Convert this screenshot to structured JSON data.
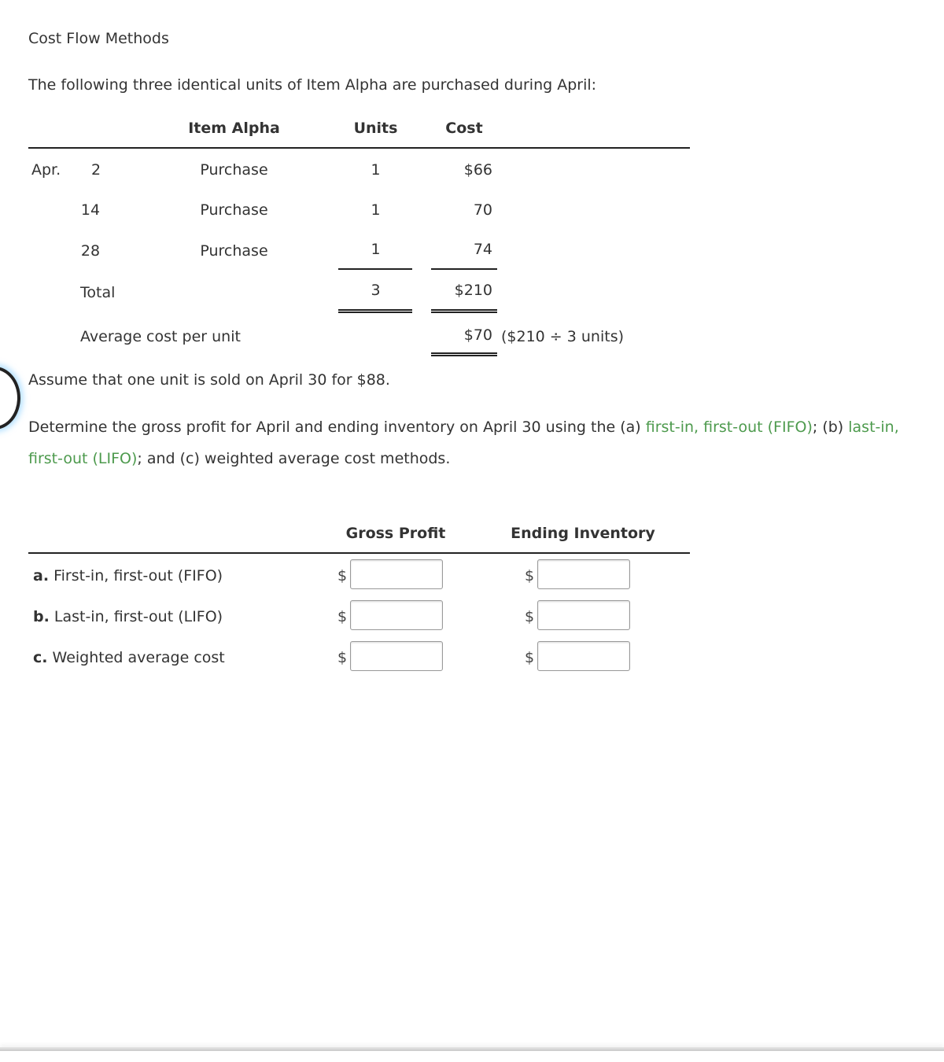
{
  "title": "Cost Flow Methods",
  "intro": "The following three identical units of Item Alpha are purchased during April:",
  "table": {
    "headers": {
      "item": "Item Alpha",
      "units": "Units",
      "cost": "Cost"
    },
    "month": "Apr.",
    "rows": [
      {
        "day": "2",
        "desc": "Purchase",
        "units": "1",
        "cost": "$66"
      },
      {
        "day": "14",
        "desc": "Purchase",
        "units": "1",
        "cost": "70"
      },
      {
        "day": "28",
        "desc": "Purchase",
        "units": "1",
        "cost": "74"
      }
    ],
    "total": {
      "label": "Total",
      "units": "3",
      "cost": "$210"
    },
    "average": {
      "label": "Average cost per unit",
      "cost": "$70",
      "note": "($210 ÷ 3 units)"
    }
  },
  "assume": "Assume that one unit is sold on April 30 for $88.",
  "question": {
    "part1": "Determine the gross profit for April and ending inventory on April 30 using the (a) ",
    "link_fifo": "first-in, first-out (FIFO)",
    "part2": "; (b) ",
    "link_lifo": "last-in, first-out (LIFO)",
    "part3": "; and (c) weighted average cost methods."
  },
  "answer": {
    "headers": {
      "gross_profit": "Gross Profit",
      "ending_inventory": "Ending Inventory"
    },
    "currency": "$",
    "rows": [
      {
        "letter": "a.",
        "label": "First-in, first-out (FIFO)",
        "gross_profit": "",
        "ending_inventory": ""
      },
      {
        "letter": "b.",
        "label": "Last-in, first-out (LIFO)",
        "gross_profit": "",
        "ending_inventory": ""
      },
      {
        "letter": "c.",
        "label": "Weighted average cost",
        "gross_profit": "",
        "ending_inventory": ""
      }
    ]
  },
  "colors": {
    "link": "#4d9a4d",
    "text": "#333333"
  }
}
